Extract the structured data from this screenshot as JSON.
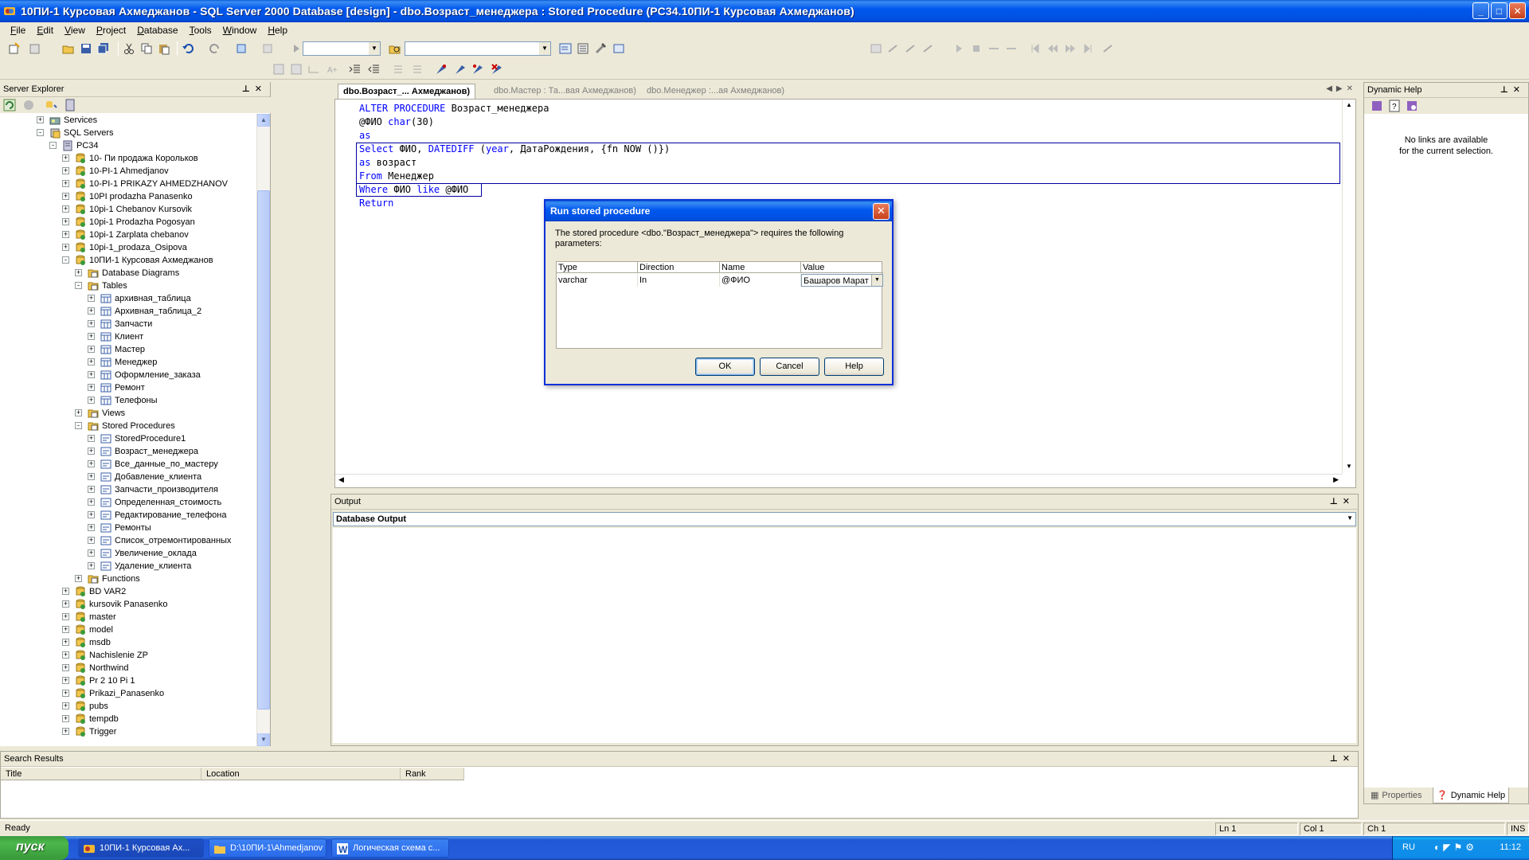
{
  "window": {
    "title": "10ПИ-1 Курсовая Ахмеджанов - SQL Server 2000 Database [design] - dbo.Возраст_менеджера : Stored Procedure (PC34.10ПИ-1 Курсовая Ахмеджанов)",
    "min": "_",
    "max": "□",
    "close": "✕"
  },
  "menu": [
    "File",
    "Edit",
    "View",
    "Project",
    "Database",
    "Tools",
    "Window",
    "Help"
  ],
  "server_explorer": {
    "title": "Server Explorer",
    "tree": [
      {
        "level": 2,
        "label": "Services",
        "exp": "+",
        "icon": "services"
      },
      {
        "level": 2,
        "label": "SQL Servers",
        "exp": "-",
        "icon": "sqlservers"
      },
      {
        "level": 3,
        "label": "PC34",
        "exp": "-",
        "icon": "server"
      },
      {
        "level": 4,
        "label": "10- Пи продажа Корольков",
        "exp": "+",
        "icon": "db"
      },
      {
        "level": 4,
        "label": "10-PI-1 Ahmedjanov",
        "exp": "+",
        "icon": "db"
      },
      {
        "level": 4,
        "label": "10-PI-1 PRIKAZY AHMEDZHANOV",
        "exp": "+",
        "icon": "db"
      },
      {
        "level": 4,
        "label": "10PI prodazha Panasenko",
        "exp": "+",
        "icon": "db"
      },
      {
        "level": 4,
        "label": "10pi-1 Chebanov Kursovik",
        "exp": "+",
        "icon": "db"
      },
      {
        "level": 4,
        "label": "10pi-1 Prodazha Pogosyan",
        "exp": "+",
        "icon": "db"
      },
      {
        "level": 4,
        "label": "10pi-1 Zarplata chebanov",
        "exp": "+",
        "icon": "db"
      },
      {
        "level": 4,
        "label": "10pi-1_prodaza_Osipova",
        "exp": "+",
        "icon": "db"
      },
      {
        "level": 4,
        "label": "10ПИ-1 Курсовая Ахмеджанов",
        "exp": "-",
        "icon": "db"
      },
      {
        "level": 5,
        "label": "Database Diagrams",
        "exp": "+",
        "icon": "folder"
      },
      {
        "level": 5,
        "label": "Tables",
        "exp": "-",
        "icon": "folder"
      },
      {
        "level": 6,
        "label": "архивная_таблица",
        "exp": "+",
        "icon": "table"
      },
      {
        "level": 6,
        "label": "Архивная_таблица_2",
        "exp": "+",
        "icon": "table"
      },
      {
        "level": 6,
        "label": "Запчасти",
        "exp": "+",
        "icon": "table"
      },
      {
        "level": 6,
        "label": "Клиент",
        "exp": "+",
        "icon": "table"
      },
      {
        "level": 6,
        "label": "Мастер",
        "exp": "+",
        "icon": "table"
      },
      {
        "level": 6,
        "label": "Менеджер",
        "exp": "+",
        "icon": "table"
      },
      {
        "level": 6,
        "label": "Оформление_заказа",
        "exp": "+",
        "icon": "table"
      },
      {
        "level": 6,
        "label": "Ремонт",
        "exp": "+",
        "icon": "table"
      },
      {
        "level": 6,
        "label": "Телефоны",
        "exp": "+",
        "icon": "table"
      },
      {
        "level": 5,
        "label": "Views",
        "exp": "+",
        "icon": "folder"
      },
      {
        "level": 5,
        "label": "Stored Procedures",
        "exp": "-",
        "icon": "folder"
      },
      {
        "level": 6,
        "label": "StoredProcedure1",
        "exp": "+",
        "icon": "proc"
      },
      {
        "level": 6,
        "label": "Возраст_менеджера",
        "exp": "+",
        "icon": "proc"
      },
      {
        "level": 6,
        "label": "Все_данные_по_мастеру",
        "exp": "+",
        "icon": "proc"
      },
      {
        "level": 6,
        "label": "Добавление_клиента",
        "exp": "+",
        "icon": "proc"
      },
      {
        "level": 6,
        "label": "Запчасти_производителя",
        "exp": "+",
        "icon": "proc"
      },
      {
        "level": 6,
        "label": "Определенная_стоимость",
        "exp": "+",
        "icon": "proc"
      },
      {
        "level": 6,
        "label": "Редактирование_телефона",
        "exp": "+",
        "icon": "proc"
      },
      {
        "level": 6,
        "label": "Ремонты",
        "exp": "+",
        "icon": "proc"
      },
      {
        "level": 6,
        "label": "Список_отремонтированных",
        "exp": "+",
        "icon": "proc"
      },
      {
        "level": 6,
        "label": "Увеличение_оклада",
        "exp": "+",
        "icon": "proc"
      },
      {
        "level": 6,
        "label": "Удаление_клиента",
        "exp": "+",
        "icon": "proc"
      },
      {
        "level": 5,
        "label": "Functions",
        "exp": "+",
        "icon": "folder"
      },
      {
        "level": 4,
        "label": "BD VAR2",
        "exp": "+",
        "icon": "db"
      },
      {
        "level": 4,
        "label": "kursovik Panasenko",
        "exp": "+",
        "icon": "db"
      },
      {
        "level": 4,
        "label": "master",
        "exp": "+",
        "icon": "db"
      },
      {
        "level": 4,
        "label": "model",
        "exp": "+",
        "icon": "db"
      },
      {
        "level": 4,
        "label": "msdb",
        "exp": "+",
        "icon": "db"
      },
      {
        "level": 4,
        "label": "Nachislenie ZP",
        "exp": "+",
        "icon": "db"
      },
      {
        "level": 4,
        "label": "Northwind",
        "exp": "+",
        "icon": "db"
      },
      {
        "level": 4,
        "label": "Pr 2 10 Pi 1",
        "exp": "+",
        "icon": "db"
      },
      {
        "level": 4,
        "label": "Prikazi_Panasenko",
        "exp": "+",
        "icon": "db"
      },
      {
        "level": 4,
        "label": "pubs",
        "exp": "+",
        "icon": "db"
      },
      {
        "level": 4,
        "label": "tempdb",
        "exp": "+",
        "icon": "db"
      },
      {
        "level": 4,
        "label": "Trigger",
        "exp": "+",
        "icon": "db"
      }
    ]
  },
  "editor": {
    "tabs": [
      {
        "label": "dbo.Возраст_... Ахмеджанов)",
        "active": true
      },
      {
        "label": "dbo.Мастер : Та...вая Ахмеджанов)",
        "active": false
      },
      {
        "label": "dbo.Менеджер :...ая Ахмеджанов)",
        "active": false
      }
    ],
    "code": [
      [
        {
          "t": "ALTER PROCEDURE",
          "k": 1
        },
        {
          "t": " Возраст_менеджера",
          "k": 0
        }
      ],
      [
        {
          "t": "@ФИО ",
          "k": 0
        },
        {
          "t": "char",
          "k": 1
        },
        {
          "t": "(30)",
          "k": 0
        }
      ],
      [
        {
          "t": "as",
          "k": 1
        }
      ],
      [
        {
          "t": "Select",
          "k": 1
        },
        {
          "t": " ФИО, ",
          "k": 0
        },
        {
          "t": "DATEDIFF",
          "k": 1
        },
        {
          "t": " (",
          "k": 0
        },
        {
          "t": "year",
          "k": 1
        },
        {
          "t": ", ДатаРождения, {fn NOW ()})",
          "k": 0
        }
      ],
      [
        {
          "t": "as",
          "k": 1
        },
        {
          "t": " возраст",
          "k": 0
        }
      ],
      [
        {
          "t": "From",
          "k": 1
        },
        {
          "t": " Менеджер",
          "k": 0
        }
      ],
      [
        {
          "t": "Where",
          "k": 1
        },
        {
          "t": " ФИО ",
          "k": 0
        },
        {
          "t": "like",
          "k": 1
        },
        {
          "t": " @ФИО",
          "k": 0
        }
      ],
      [
        {
          "t": "Return",
          "k": 1
        }
      ]
    ]
  },
  "output": {
    "title": "Output",
    "combo_value": "Database Output"
  },
  "dynamic_help": {
    "title": "Dynamic Help",
    "message_line1": "No links are available",
    "message_line2": "for the current selection.",
    "tab_properties": "Properties",
    "tab_dynamic_help": "Dynamic Help"
  },
  "search_results": {
    "title": "Search Results",
    "columns": [
      "Title",
      "Location",
      "Rank"
    ]
  },
  "status": {
    "ready": "Ready",
    "ln": "Ln 1",
    "col": "Col 1",
    "ch": "Ch 1",
    "ins": "INS"
  },
  "dialog": {
    "title": "Run stored procedure",
    "close": "✕",
    "message": "The stored procedure <dbo.\"Возраст_менеджера\"> requires the following parameters:",
    "columns": [
      "Type",
      "Direction",
      "Name",
      "Value"
    ],
    "row": {
      "type": "varchar",
      "direction": "In",
      "name": "@ФИО",
      "value": "Башаров Марат"
    },
    "ok": "OK",
    "cancel": "Cancel",
    "help": "Help"
  },
  "taskbar": {
    "start": "пуск",
    "tasks": [
      {
        "label": "10ПИ-1 Курсовая Ах...",
        "active": true
      },
      {
        "label": "D:\\10ПИ-1\\Ahmedjanov",
        "active": false
      },
      {
        "label": "Логическая схема с...",
        "active": false
      }
    ],
    "lang": "RU",
    "clock": "11:12"
  },
  "colors": {
    "keyword": "#0000ff",
    "xp_blue": "#0058ee",
    "dialog_border": "#0831d9"
  }
}
